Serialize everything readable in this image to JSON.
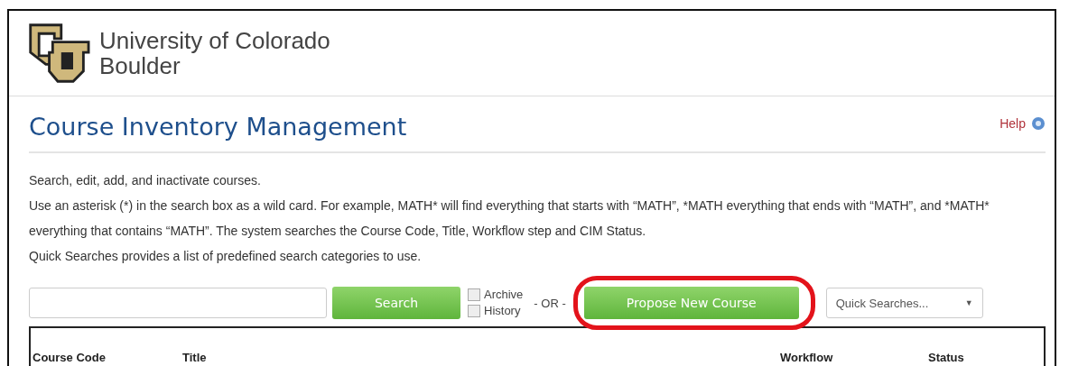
{
  "header": {
    "org_line_1": "University of Colorado",
    "org_line_2": "Boulder"
  },
  "page": {
    "title": "Course Inventory Management",
    "help_link": "Help"
  },
  "intro": [
    "Search, edit, add, and inactivate courses.",
    "Use an asterisk (*) in the search box as a wild card. For example, MATH* will find everything that starts with “MATH”, *MATH everything that ends with “MATH”, and *MATH* everything that contains “MATH”. The system searches the Course Code, Title, Workflow step and CIM Status.",
    "Quick Searches provides a list of predefined search categories to use."
  ],
  "search": {
    "button": "Search",
    "options": [
      {
        "label": "Archive",
        "checked": false
      },
      {
        "label": "History",
        "checked": false
      }
    ],
    "separator": "- OR -",
    "propose_button": "Propose New Course",
    "propose_highlighted": true,
    "quick_searches": {
      "placeholder": "Quick Searches...",
      "arrow": "▼"
    }
  },
  "table": {
    "columns": [
      "Course Code",
      "Title",
      "Workflow",
      "Status"
    ]
  }
}
